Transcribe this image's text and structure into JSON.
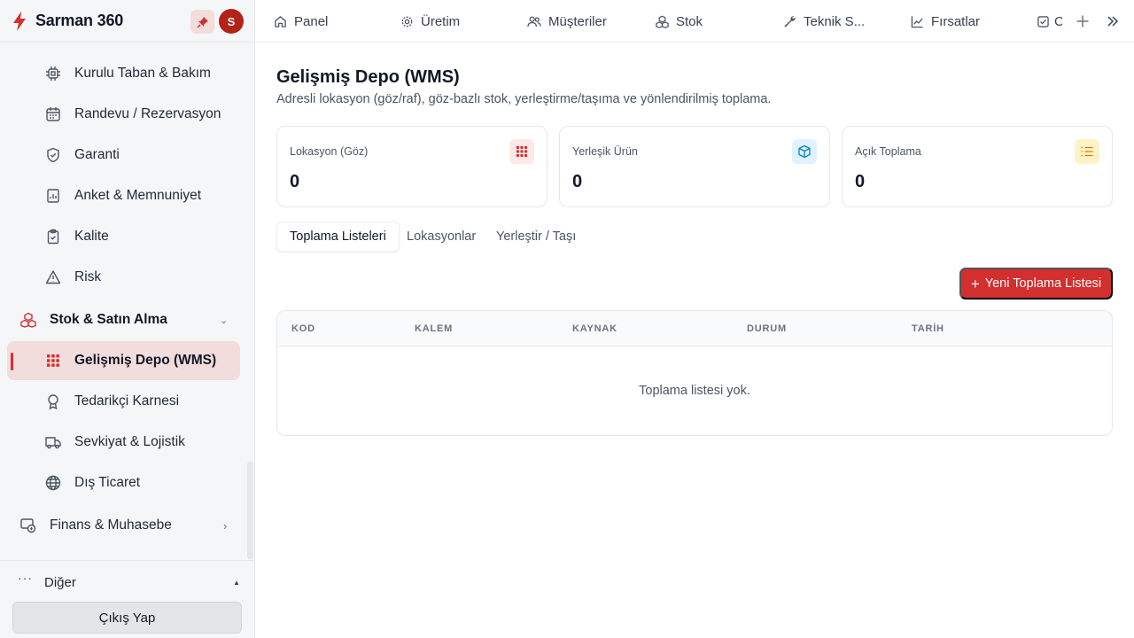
{
  "brand": {
    "name": "Sarman 360",
    "avatar_initial": "S"
  },
  "sidebar": {
    "items": [
      {
        "label": "Kurulu Taban & Bakım",
        "icon": "chip-icon"
      },
      {
        "label": "Randevu / Rezervasyon",
        "icon": "calendar-icon"
      },
      {
        "label": "Garanti",
        "icon": "shield-icon"
      },
      {
        "label": "Anket & Memnuniyet",
        "icon": "survey-icon"
      },
      {
        "label": "Kalite",
        "icon": "clipboard-check-icon"
      },
      {
        "label": "Risk",
        "icon": "warning-icon"
      }
    ],
    "group_stock": {
      "label": "Stok & Satın Alma",
      "icon": "boxes-icon"
    },
    "stock_items": [
      {
        "label": "Gelişmiş Depo (WMS)",
        "icon": "grid-icon",
        "active": true
      },
      {
        "label": "Tedarikçi Karnesi",
        "icon": "award-icon"
      },
      {
        "label": "Sevkiyat & Lojistik",
        "icon": "truck-icon"
      },
      {
        "label": "Dış Ticaret",
        "icon": "globe-icon"
      }
    ],
    "group_finance": {
      "label": "Finans & Muhasebe",
      "icon": "finance-icon"
    },
    "other": {
      "label": "Diğer",
      "dots": "···"
    },
    "logout": "Çıkış Yap"
  },
  "topbar": {
    "tabs": [
      {
        "label": "Panel",
        "icon": "home-icon"
      },
      {
        "label": "Üretim",
        "icon": "gear-icon"
      },
      {
        "label": "Müşteriler",
        "icon": "users-icon"
      },
      {
        "label": "Stok",
        "icon": "boxes-icon"
      },
      {
        "label": "Teknik S...",
        "icon": "wrench-icon"
      },
      {
        "label": "Fırsatlar",
        "icon": "trend-icon"
      },
      {
        "label": "C",
        "icon": "checkbox-icon"
      }
    ]
  },
  "page": {
    "title": "Gelişmiş Depo (WMS)",
    "subtitle": "Adresli lokasyon (göz/raf), göz-bazlı stok, yerleştirme/taşıma ve yönlendirilmiş toplama."
  },
  "stats": [
    {
      "label": "Lokasyon (Göz)",
      "value": "0",
      "icon": "grid-icon",
      "color": "#d32f2f",
      "bg": "#fde8e8"
    },
    {
      "label": "Yerleşik Ürün",
      "value": "0",
      "icon": "cube-icon",
      "color": "#0284c7",
      "bg": "#e0f2fe"
    },
    {
      "label": "Açık Toplama",
      "value": "0",
      "icon": "list-icon",
      "color": "#d97706",
      "bg": "#fef3c7"
    }
  ],
  "subtabs": [
    {
      "label": "Toplama Listeleri",
      "active": true
    },
    {
      "label": "Lokasyonlar",
      "active": false
    },
    {
      "label": "Yerleştir / Taşı",
      "active": false
    }
  ],
  "actions": {
    "new_pick_list": "Yeni Toplama Listesi"
  },
  "table": {
    "columns": [
      "KOD",
      "KALEM",
      "KAYNAK",
      "DURUM",
      "TARİH"
    ],
    "empty_text": "Toplama listesi yok."
  },
  "colors": {
    "accent": "#d32f2f",
    "active_bg": "#f3dcdc"
  }
}
